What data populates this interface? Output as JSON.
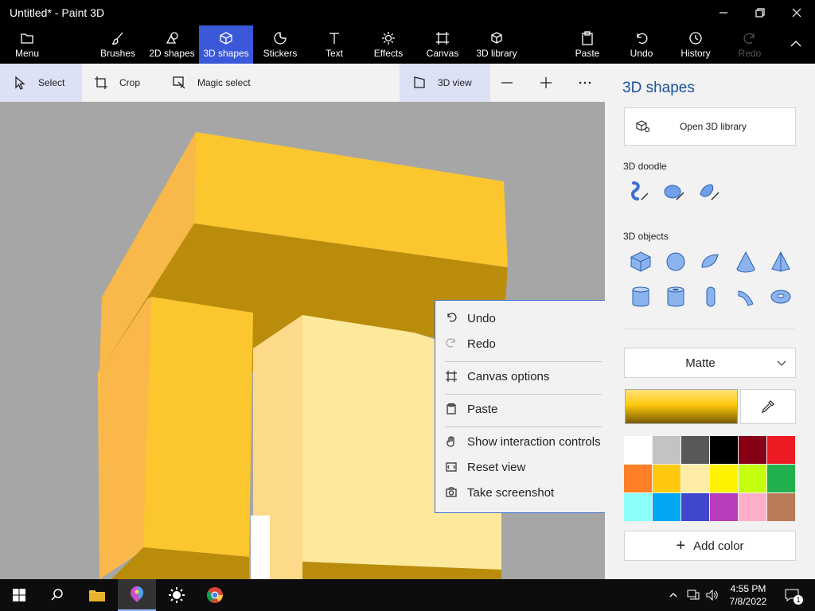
{
  "window": {
    "title": "Untitled* - Paint 3D"
  },
  "ribbon": {
    "menu": "Menu",
    "brushes": "Brushes",
    "shapes2d": "2D shapes",
    "shapes3d": "3D shapes",
    "stickers": "Stickers",
    "text": "Text",
    "effects": "Effects",
    "canvas": "Canvas",
    "library3d": "3D library",
    "paste": "Paste",
    "undo": "Undo",
    "history": "History",
    "redo": "Redo"
  },
  "toolbar": {
    "select": "Select",
    "crop": "Crop",
    "magic_select": "Magic select",
    "view3d": "3D view"
  },
  "context_menu": {
    "items": [
      "Undo",
      "Redo",
      "Canvas options",
      "Paste",
      "Show interaction controls",
      "Reset view",
      "Take screenshot"
    ]
  },
  "panel": {
    "title": "3D shapes",
    "open_library": "Open 3D library",
    "doodle_label": "3D doodle",
    "objects_label": "3D objects",
    "material": "Matte",
    "add_color": "Add color",
    "swatches": [
      "#ffffff",
      "#c3c3c3",
      "#585858",
      "#000000",
      "#880015",
      "#ed1c24",
      "#ff7f27",
      "#ffc90e",
      "#fdeca6",
      "#fff200",
      "#c4ff0e",
      "#22b14c",
      "#8cfffb",
      "#00a8f3",
      "#3f48cc",
      "#b83dba",
      "#ffaec8",
      "#b97a57"
    ],
    "selected_color": "#ffc90e"
  },
  "taskbar": {
    "time": "4:55 PM",
    "date": "7/8/2022",
    "notifications": "1"
  }
}
